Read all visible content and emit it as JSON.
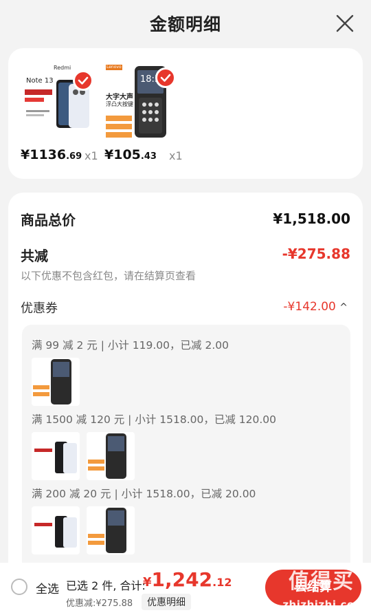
{
  "header": {
    "title": "金额明细"
  },
  "products": [
    {
      "brand": "Redmi",
      "model": "Note 13",
      "price_int": "¥1136",
      "price_dec": ".69",
      "qty": "x1"
    },
    {
      "brand": "Lenovo",
      "screen_time": "18:30",
      "tag1": "大字大声",
      "tag2": "浮凸大按键",
      "price_int": "¥105",
      "price_dec": ".43",
      "qty": "x1"
    }
  ],
  "summary": {
    "total_label": "商品总价",
    "total_value": "¥1,518.00",
    "discount_label": "共减",
    "discount_value": "-¥275.88",
    "note": "以下优惠不包含红包，请在结算页查看",
    "coupon_label": "优惠券",
    "coupon_value": "-¥142.00",
    "coupon_toggle": "^",
    "rules": [
      "满 99 减 2 元 | 小计 119.00，已减 2.00",
      "满 1500 减 120 元 | 小计 1518.00，已减 120.00",
      "满 200 减 20 元 | 小计 1518.00，已减 20.00"
    ]
  },
  "bottom": {
    "select_all": "全选",
    "selected": "已选 2 件, 合计:",
    "total_symbol": "¥",
    "total_int": "1,242",
    "total_dec": ".12",
    "discount_text": "优惠减:¥275.88",
    "detail_button": "优惠明细",
    "checkout": "去结算"
  },
  "watermark": {
    "text": "值得买",
    "url": "zhizhizhi.com"
  },
  "colors": {
    "accent": "#e7372c",
    "background": "#f3f3f3"
  }
}
